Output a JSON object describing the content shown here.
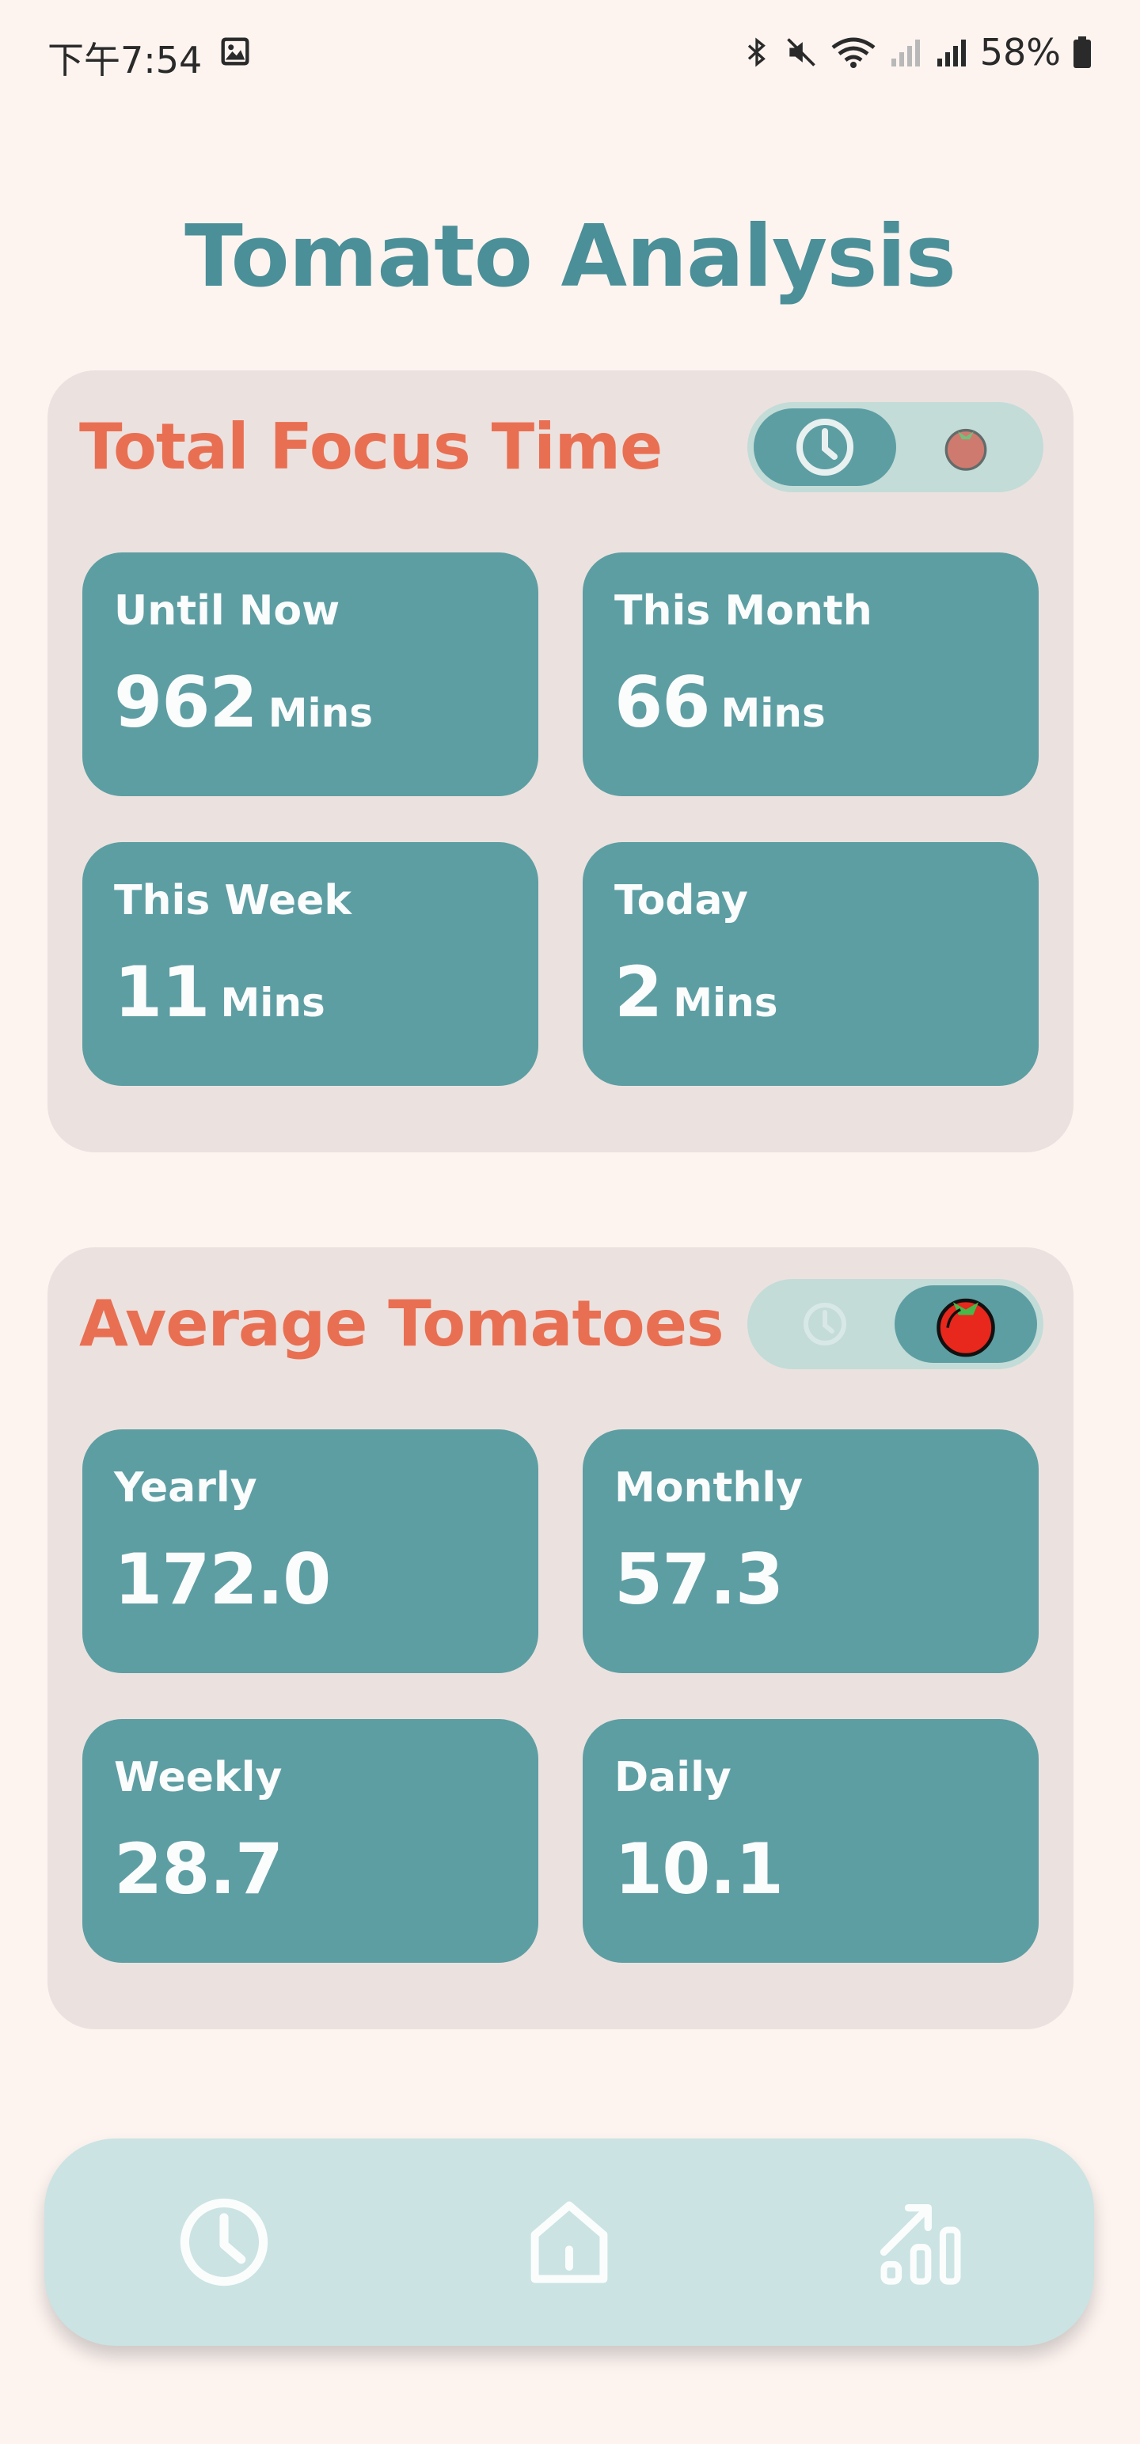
{
  "status_bar": {
    "time": "下午7:54",
    "battery": "58%"
  },
  "title": "Tomato Analysis",
  "total_focus": {
    "title": "Total Focus Time",
    "toggle_active": "clock",
    "stats": [
      {
        "label": "Until Now",
        "value": "962",
        "unit": "Mins"
      },
      {
        "label": "This Month",
        "value": "66",
        "unit": "Mins"
      },
      {
        "label": "This Week",
        "value": "11",
        "unit": "Mins"
      },
      {
        "label": "Today",
        "value": "2",
        "unit": "Mins"
      }
    ]
  },
  "average_tomatoes": {
    "title": "Average Tomatoes",
    "toggle_active": "tomato",
    "stats": [
      {
        "label": "Yearly",
        "value": "172.0"
      },
      {
        "label": "Monthly",
        "value": "57.3"
      },
      {
        "label": "Weekly",
        "value": "28.7"
      },
      {
        "label": "Daily",
        "value": "10.1"
      }
    ]
  },
  "bottom_nav": {
    "items": [
      "timer-icon",
      "home-icon",
      "stats-icon"
    ]
  },
  "colors": {
    "background": "#fdf4f0",
    "title": "#4b8f98",
    "card": "#ebe2df",
    "accent": "#e96f52",
    "tile": "#5d9ea3",
    "toggle_track": "#c3dcd8",
    "nav": "#cbe3e3"
  }
}
